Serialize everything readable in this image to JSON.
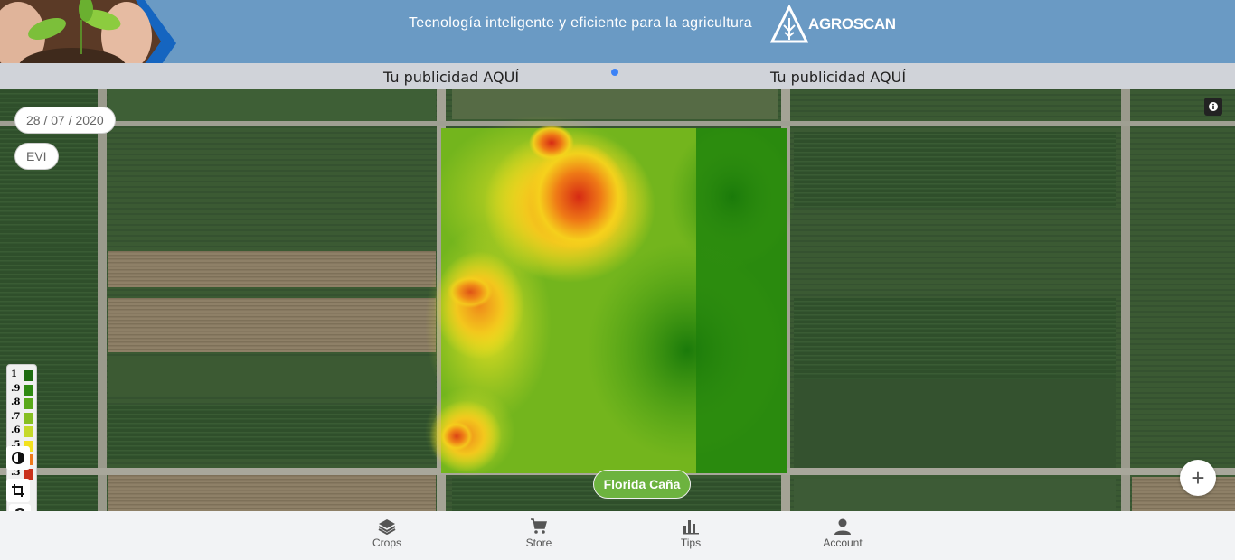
{
  "header": {
    "tagline": "Tecnología inteligente y eficiente para la agricultura",
    "logo_text": "AGROSCAN",
    "background": "#6a9ac4"
  },
  "ads": {
    "left": "Tu publicidad AQUÍ",
    "right": "Tu publicidad AQUÍ"
  },
  "map": {
    "date": "28 / 07 / 2020",
    "index": "EVI",
    "field_label": "Florida Caña",
    "legend": [
      {
        "label": "1",
        "color": "#1e6b10"
      },
      {
        "label": ".9",
        "color": "#2f8a12"
      },
      {
        "label": ".8",
        "color": "#59a91a"
      },
      {
        "label": ".7",
        "color": "#86bf22"
      },
      {
        "label": ".6",
        "color": "#c5d92a"
      },
      {
        "label": ".5",
        "color": "#f3e21e"
      },
      {
        "label": ".4",
        "color": "#f07a1c"
      },
      {
        "label": ".3",
        "color": "#c9301b"
      }
    ],
    "controls": [
      "location-icon",
      "contrast-icon",
      "crop-icon",
      "info-icon",
      "zoom-in-icon"
    ]
  },
  "nav": {
    "items": [
      {
        "label": "Crops",
        "icon": "layers-icon"
      },
      {
        "label": "Store",
        "icon": "cart-icon"
      },
      {
        "label": "Tips",
        "icon": "bar-chart-icon"
      },
      {
        "label": "Account",
        "icon": "person-icon"
      }
    ]
  }
}
